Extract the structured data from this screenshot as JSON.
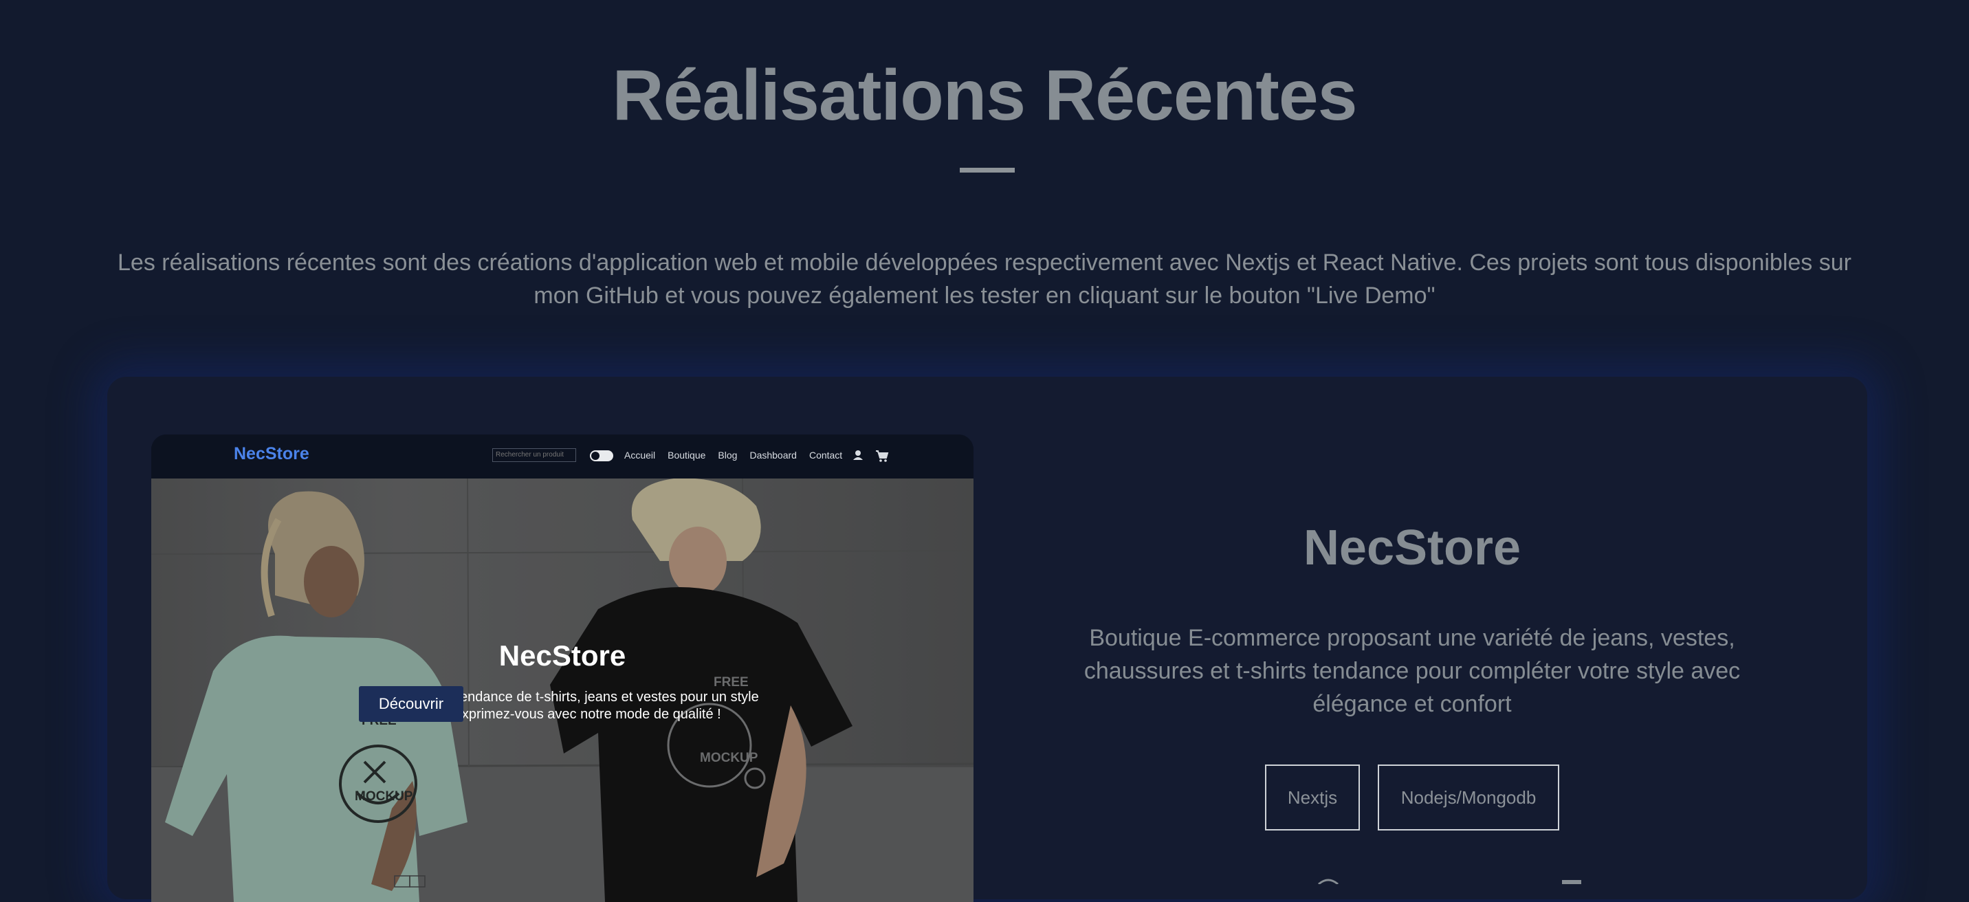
{
  "section": {
    "title": "Réalisations Récentes",
    "intro": "Les réalisations récentes sont des créations d'application web et mobile développées respectivement avec Nextjs et React Native. Ces projets sont tous disponibles sur mon GitHub et vous pouvez également les tester en cliquant sur le bouton \"Live Demo\""
  },
  "project": {
    "title": "NecStore",
    "description": "Boutique E-commerce proposant une variété de jeans, vestes, chaussures et t-shirts tendance pour compléter votre style avec élégance et confort",
    "tags": [
      "Nextjs",
      "Nodejs/Mongodb"
    ]
  },
  "preview": {
    "nav": {
      "logo": "NecStore",
      "search_placeholder": "Rechercher un produit",
      "links": [
        "Accueil",
        "Boutique",
        "Blog",
        "Dashboard",
        "Contact"
      ]
    },
    "hero": {
      "title": "NecStore",
      "description": "Une collection tendance de t-shirts, jeans et vestes pour un style unique. Exprimez-vous avec notre mode de qualité !",
      "button": "Découvrir",
      "shirt_left": {
        "top": "FREE",
        "bottom": "MOCKUP"
      },
      "shirt_right": {
        "top": "FREE",
        "bottom": "MOCKUP"
      }
    }
  },
  "colors": {
    "background": "#121a2e",
    "accent": "#4b83ea",
    "button": "#1c2e59"
  }
}
